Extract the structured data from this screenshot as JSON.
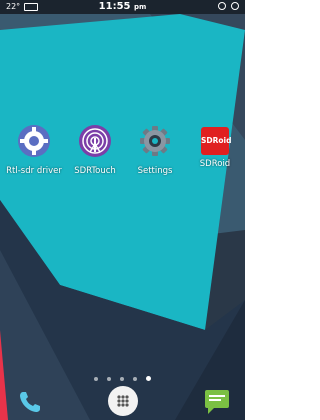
{
  "status_bar": {
    "temperature": "22°",
    "time": "11:55",
    "time_suffix": "pm"
  },
  "apps": [
    {
      "label": "Rtl-sdr driver",
      "icon": "rtl-sdr-gear-icon"
    },
    {
      "label": "SDRTouch",
      "icon": "sdrtouch-antenna-icon"
    },
    {
      "label": "Settings",
      "icon": "settings-gear-icon"
    },
    {
      "label": "SDRoid",
      "icon": "sdroid-icon",
      "icon_text": "SDRoid"
    }
  ],
  "page_indicator": {
    "count": 5,
    "active": 4
  },
  "dock": [
    {
      "icon": "phone-icon"
    },
    {
      "icon": "app-drawer-icon"
    },
    {
      "icon": "messaging-icon"
    }
  ],
  "colors": {
    "wallpaper_teal": "#1ab6c4",
    "wallpaper_dark": "#2a3848",
    "accent_red": "#e8334a"
  }
}
